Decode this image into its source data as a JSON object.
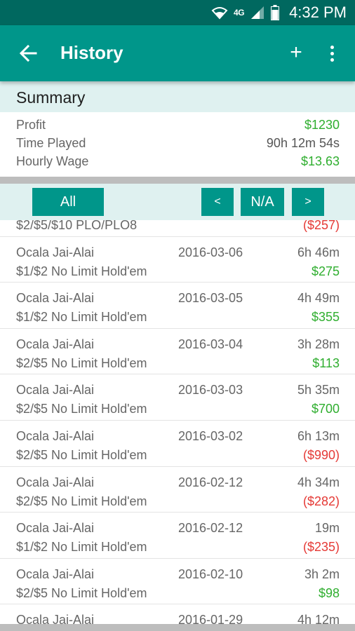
{
  "status_bar": {
    "time": "4:32 PM",
    "network_label": "4G",
    "icons": [
      "wifi-icon",
      "signal-icon",
      "battery-icon"
    ]
  },
  "app_bar": {
    "title": "History",
    "back_icon": "arrow-left-icon",
    "add_label": "+",
    "menu_icon": "more-vert-icon"
  },
  "summary": {
    "title": "Summary",
    "rows": [
      {
        "label": "Profit",
        "value": "$1230"
      },
      {
        "label": "Time Played",
        "value": "90h 12m 54s"
      },
      {
        "label": "Hourly Wage",
        "value": "$13.63"
      }
    ]
  },
  "filter": {
    "all_label": "All",
    "prev_label": "<",
    "period_label": "N/A",
    "next_label": ">"
  },
  "sessions": [
    {
      "location": "",
      "date": "",
      "duration": "",
      "game": "$2/$5/$10 PLO/PLO8",
      "amount": "($257)",
      "negative": true
    },
    {
      "location": "Ocala Jai-Alai",
      "date": "2016-03-06",
      "duration": "6h 46m",
      "game": "$1/$2 No Limit Hold'em",
      "amount": "$275",
      "negative": false
    },
    {
      "location": "Ocala Jai-Alai",
      "date": "2016-03-05",
      "duration": "4h 49m",
      "game": "$1/$2 No Limit Hold'em",
      "amount": "$355",
      "negative": false
    },
    {
      "location": "Ocala Jai-Alai",
      "date": "2016-03-04",
      "duration": "3h 28m",
      "game": "$2/$5 No Limit Hold'em",
      "amount": "$113",
      "negative": false
    },
    {
      "location": "Ocala Jai-Alai",
      "date": "2016-03-03",
      "duration": "5h 35m",
      "game": "$2/$5 No Limit Hold'em",
      "amount": "$700",
      "negative": false
    },
    {
      "location": "Ocala Jai-Alai",
      "date": "2016-03-02",
      "duration": "6h 13m",
      "game": "$2/$5 No Limit Hold'em",
      "amount": "($990)",
      "negative": true
    },
    {
      "location": "Ocala Jai-Alai",
      "date": "2016-02-12",
      "duration": "4h 34m",
      "game": "$2/$5 No Limit Hold'em",
      "amount": "($282)",
      "negative": true
    },
    {
      "location": "Ocala Jai-Alai",
      "date": "2016-02-12",
      "duration": "19m",
      "game": "$1/$2 No Limit Hold'em",
      "amount": "($235)",
      "negative": true
    },
    {
      "location": "Ocala Jai-Alai",
      "date": "2016-02-10",
      "duration": "3h 2m",
      "game": "$2/$5 No Limit Hold'em",
      "amount": "$98",
      "negative": false
    },
    {
      "location": "Ocala Jai-Alai",
      "date": "2016-01-29",
      "duration": "4h 12m",
      "game": "",
      "amount": "",
      "negative": false
    }
  ],
  "colors": {
    "primary": "#00968a",
    "primary_dark": "#00685f",
    "header_tint": "#dff1f0",
    "positive": "#2fae2f",
    "negative": "#e53935"
  }
}
